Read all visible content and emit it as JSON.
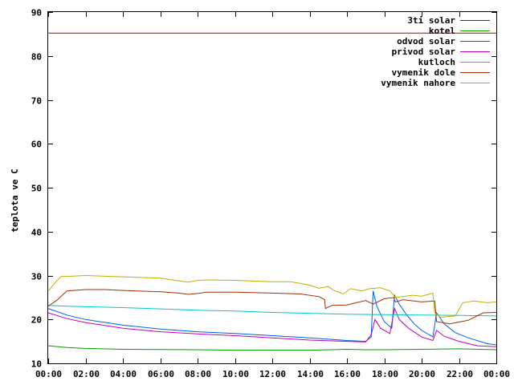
{
  "chart_data": {
    "type": "line",
    "title": "",
    "xlabel": "",
    "ylabel": "teplota ve C",
    "ylim": [
      10,
      90
    ],
    "xlim": [
      "00:00",
      "24:00"
    ],
    "yticks": [
      10,
      20,
      30,
      40,
      50,
      60,
      70,
      80,
      90
    ],
    "xticks": [
      "00:00",
      "02:00",
      "04:00",
      "06:00",
      "08:00",
      "10:00",
      "12:00",
      "14:00",
      "16:00",
      "18:00",
      "20:00",
      "22:00",
      "00:00"
    ],
    "grid": false,
    "legend": "top-right",
    "series": [
      {
        "name": "3ti solar",
        "color": "#c00000",
        "points": [
          [
            0,
            85.2
          ],
          [
            24,
            85.2
          ]
        ]
      },
      {
        "name": "kotel",
        "color": "#00a000",
        "points": [
          [
            0,
            14.0
          ],
          [
            1,
            13.6
          ],
          [
            2,
            13.4
          ],
          [
            4,
            13.2
          ],
          [
            8,
            13.1
          ],
          [
            10,
            13.0
          ],
          [
            14,
            13.0
          ],
          [
            16,
            13.2
          ],
          [
            17,
            13.1
          ],
          [
            18,
            13.1
          ],
          [
            20,
            13.2
          ],
          [
            22,
            13.3
          ],
          [
            24,
            13.1
          ]
        ]
      },
      {
        "name": "odvod solar",
        "color": "#0060e0",
        "points": [
          [
            0,
            22.5
          ],
          [
            1,
            21.0
          ],
          [
            2,
            20.0
          ],
          [
            4,
            18.7
          ],
          [
            6,
            17.8
          ],
          [
            8,
            17.2
          ],
          [
            10,
            16.8
          ],
          [
            12,
            16.3
          ],
          [
            14,
            15.8
          ],
          [
            16,
            15.2
          ],
          [
            17.0,
            15.0
          ],
          [
            17.3,
            16.0
          ],
          [
            17.4,
            26.5
          ],
          [
            17.6,
            23.0
          ],
          [
            18.0,
            19.5
          ],
          [
            18.4,
            18.0
          ],
          [
            18.55,
            25.5
          ],
          [
            18.8,
            23.5
          ],
          [
            19.2,
            21.0
          ],
          [
            19.6,
            19.0
          ],
          [
            20.0,
            17.5
          ],
          [
            20.6,
            16.0
          ],
          [
            20.8,
            21.5
          ],
          [
            21.2,
            19.0
          ],
          [
            21.8,
            17.0
          ],
          [
            22.5,
            15.8
          ],
          [
            23.5,
            14.5
          ],
          [
            24,
            14.2
          ]
        ]
      },
      {
        "name": "privod solar",
        "color": "#c000c0",
        "points": [
          [
            0,
            21.5
          ],
          [
            1,
            20.2
          ],
          [
            2,
            19.3
          ],
          [
            4,
            18.0
          ],
          [
            6,
            17.2
          ],
          [
            8,
            16.7
          ],
          [
            10,
            16.3
          ],
          [
            12,
            15.8
          ],
          [
            14,
            15.3
          ],
          [
            16,
            15.0
          ],
          [
            17.0,
            14.9
          ],
          [
            17.3,
            16.5
          ],
          [
            17.5,
            20.0
          ],
          [
            17.8,
            18.0
          ],
          [
            18.3,
            16.8
          ],
          [
            18.55,
            22.5
          ],
          [
            18.8,
            20.0
          ],
          [
            19.3,
            18.0
          ],
          [
            20.0,
            16.0
          ],
          [
            20.6,
            15.2
          ],
          [
            20.8,
            17.5
          ],
          [
            21.2,
            16.2
          ],
          [
            22.0,
            15.0
          ],
          [
            23.0,
            14.0
          ],
          [
            24,
            13.8
          ]
        ]
      },
      {
        "name": "kutloch",
        "color": "#00c8c8",
        "points": [
          [
            0,
            23.2
          ],
          [
            1,
            23.0
          ],
          [
            2,
            22.9
          ],
          [
            4,
            22.7
          ],
          [
            6,
            22.4
          ],
          [
            8,
            22.1
          ],
          [
            10,
            21.9
          ],
          [
            12,
            21.6
          ],
          [
            14,
            21.4
          ],
          [
            16,
            21.2
          ],
          [
            18,
            21.1
          ],
          [
            20,
            21.0
          ],
          [
            22,
            20.9
          ],
          [
            24,
            20.8
          ]
        ]
      },
      {
        "name": "vymenik dole",
        "color": "#a03000",
        "points": [
          [
            0,
            23.0
          ],
          [
            0.5,
            24.5
          ],
          [
            1.0,
            26.5
          ],
          [
            2,
            26.8
          ],
          [
            3,
            26.8
          ],
          [
            4,
            26.6
          ],
          [
            6,
            26.3
          ],
          [
            7,
            26.0
          ],
          [
            7.5,
            25.7
          ],
          [
            8,
            25.9
          ],
          [
            8.5,
            26.2
          ],
          [
            10,
            26.2
          ],
          [
            12,
            26.0
          ],
          [
            13.5,
            25.8
          ],
          [
            14.5,
            25.2
          ],
          [
            14.8,
            24.5
          ],
          [
            14.85,
            22.5
          ],
          [
            15.2,
            23.2
          ],
          [
            16,
            23.3
          ],
          [
            16.5,
            23.8
          ],
          [
            17,
            24.3
          ],
          [
            17.4,
            23.5
          ],
          [
            18,
            24.7
          ],
          [
            18.5,
            25.0
          ],
          [
            18.6,
            24.0
          ],
          [
            19,
            24.5
          ],
          [
            20,
            24.0
          ],
          [
            20.7,
            24.2
          ],
          [
            20.8,
            19.5
          ],
          [
            21.5,
            19.0
          ],
          [
            22.5,
            19.8
          ],
          [
            23.3,
            21.5
          ],
          [
            24,
            21.6
          ]
        ]
      },
      {
        "name": "vymenik nahore",
        "color": "#c0b000",
        "points": [
          [
            0,
            26.5
          ],
          [
            0.4,
            28.5
          ],
          [
            0.7,
            29.8
          ],
          [
            1,
            29.8
          ],
          [
            2,
            30.0
          ],
          [
            4,
            29.7
          ],
          [
            6,
            29.4
          ],
          [
            7,
            28.8
          ],
          [
            7.5,
            28.5
          ],
          [
            8,
            28.9
          ],
          [
            8.5,
            29.0
          ],
          [
            10,
            28.9
          ],
          [
            12,
            28.6
          ],
          [
            13,
            28.6
          ],
          [
            14,
            27.8
          ],
          [
            14.5,
            27.1
          ],
          [
            15,
            27.5
          ],
          [
            15.3,
            26.6
          ],
          [
            15.8,
            25.8
          ],
          [
            16.2,
            27.0
          ],
          [
            16.8,
            26.5
          ],
          [
            17.2,
            27.0
          ],
          [
            17.8,
            27.2
          ],
          [
            18.3,
            26.5
          ],
          [
            18.6,
            25.0
          ],
          [
            19,
            25.2
          ],
          [
            19.5,
            25.5
          ],
          [
            20,
            25.3
          ],
          [
            20.6,
            26.0
          ],
          [
            20.7,
            21.5
          ],
          [
            21,
            20.5
          ],
          [
            21.8,
            20.8
          ],
          [
            22.2,
            23.8
          ],
          [
            22.8,
            24.2
          ],
          [
            23.5,
            23.8
          ],
          [
            24,
            24.0
          ]
        ]
      }
    ]
  }
}
